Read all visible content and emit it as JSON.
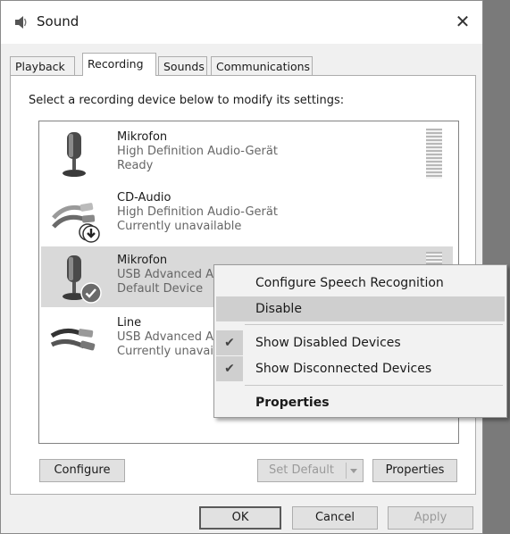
{
  "window": {
    "title": "Sound",
    "close_glyph": "✕"
  },
  "tabs": [
    {
      "label": "Playback"
    },
    {
      "label": "Recording"
    },
    {
      "label": "Sounds"
    },
    {
      "label": "Communications"
    }
  ],
  "active_tab": "Recording",
  "instruction": "Select a recording device below to modify its settings:",
  "devices": [
    {
      "name": "Mikrofon",
      "description": "High Definition Audio-Gerät",
      "status": "Ready",
      "icon": "microphone-icon"
    },
    {
      "name": "CD-Audio",
      "description": "High Definition Audio-Gerät",
      "status": "Currently unavailable",
      "icon": "cd-audio-cable-icon",
      "badge": "down-arrow-icon"
    },
    {
      "name": "Mikrofon",
      "description": "USB Advanced A",
      "status": "Default Device",
      "icon": "microphone-icon",
      "badge": "check-badge-icon",
      "selected": true
    },
    {
      "name": "Line",
      "description": "USB Advanced A",
      "status": "Currently unavai",
      "icon": "line-cable-icon"
    }
  ],
  "context_menu": {
    "configure_speech": "Configure Speech Recognition",
    "disable": "Disable",
    "show_disabled": "Show Disabled Devices",
    "show_disconnected": "Show Disconnected Devices",
    "properties": "Properties",
    "check_glyph": "✔"
  },
  "buttons": {
    "configure": "Configure",
    "set_default": "Set Default",
    "properties": "Properties",
    "ok": "OK",
    "cancel": "Cancel",
    "apply": "Apply"
  },
  "colors": {
    "selection": "#d9d9d9",
    "menu_highlight": "#cfcfcf",
    "window_bg": "#f0f0f0"
  }
}
